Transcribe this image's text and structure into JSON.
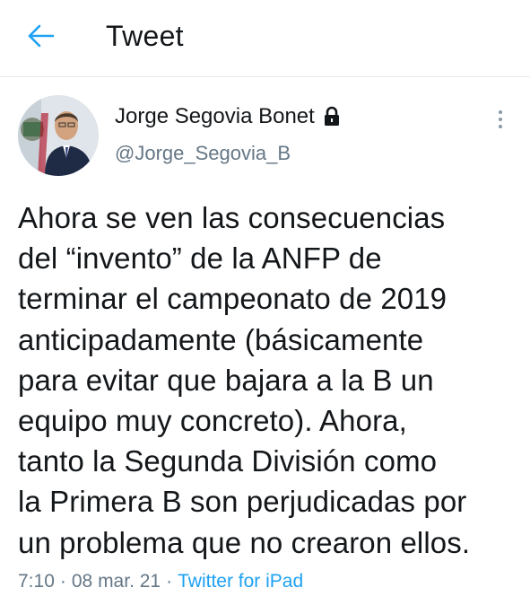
{
  "header": {
    "back_icon": "arrow-left-icon",
    "title": "Tweet",
    "accent_color": "#1da1f2"
  },
  "tweet": {
    "author": {
      "name": "Jorge Segovia Bonet",
      "handle": "@Jorge_Segovia_B",
      "protected_icon": "lock-icon"
    },
    "more_icon": "more-vertical-icon",
    "text_lines": [
      "Ahora se ven las consecuencias",
      "del “invento” de la ANFP de",
      "terminar el campeonato de 2019",
      "anticipadamente (básicamente",
      "para evitar que bajara a la B un",
      "equipo muy concreto). Ahora,",
      "tanto la Segunda División como",
      "la Primera B son perjudicadas por",
      "un problema que no crearon ellos."
    ],
    "time": "7:10",
    "separator": "·",
    "date": "08 mar. 21",
    "source": "Twitter for iPad"
  }
}
